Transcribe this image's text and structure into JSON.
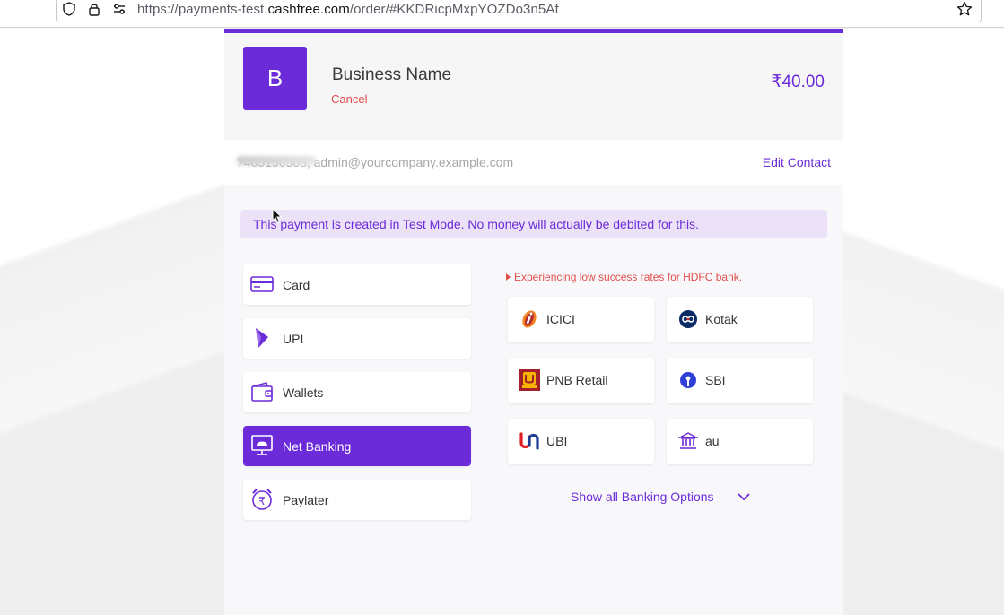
{
  "browser": {
    "url_prefix": "https://payments-test.",
    "url_domain": "cashfree.com",
    "url_path": "/order/#KKDRicpMxpYOZDo3n5Af"
  },
  "header": {
    "logo_letter": "B",
    "business_name": "Business Name",
    "cancel_label": "Cancel",
    "amount": "₹40.00"
  },
  "contact": {
    "text": "7405156508, admin@yourcompany.example.com",
    "edit_label": "Edit Contact"
  },
  "notice": {
    "test_mode": "This payment is created in Test Mode. No money will actually be debited for this."
  },
  "payment_methods": [
    {
      "label": "Card",
      "icon": "card-icon",
      "active": false
    },
    {
      "label": "UPI",
      "icon": "upi-icon",
      "active": false
    },
    {
      "label": "Wallets",
      "icon": "wallet-icon",
      "active": false
    },
    {
      "label": "Net Banking",
      "icon": "net-banking-icon",
      "active": true
    },
    {
      "label": "Paylater",
      "icon": "paylater-icon",
      "active": false
    }
  ],
  "netbanking": {
    "warning": "Experiencing low success rates for HDFC bank.",
    "banks": [
      {
        "label": "ICICI",
        "icon": "icici-logo-icon"
      },
      {
        "label": "Kotak",
        "icon": "kotak-logo-icon"
      },
      {
        "label": "PNB Retail",
        "icon": "pnb-logo-icon"
      },
      {
        "label": "SBI",
        "icon": "sbi-logo-icon"
      },
      {
        "label": "UBI",
        "icon": "ubi-logo-icon"
      },
      {
        "label": "au",
        "icon": "bank-building-icon"
      }
    ],
    "show_all_label": "Show all Banking Options"
  },
  "colors": {
    "brand": "#6c2bd9",
    "cancel_red": "#e24c4b",
    "notice_bg": "#ebe2f7"
  }
}
